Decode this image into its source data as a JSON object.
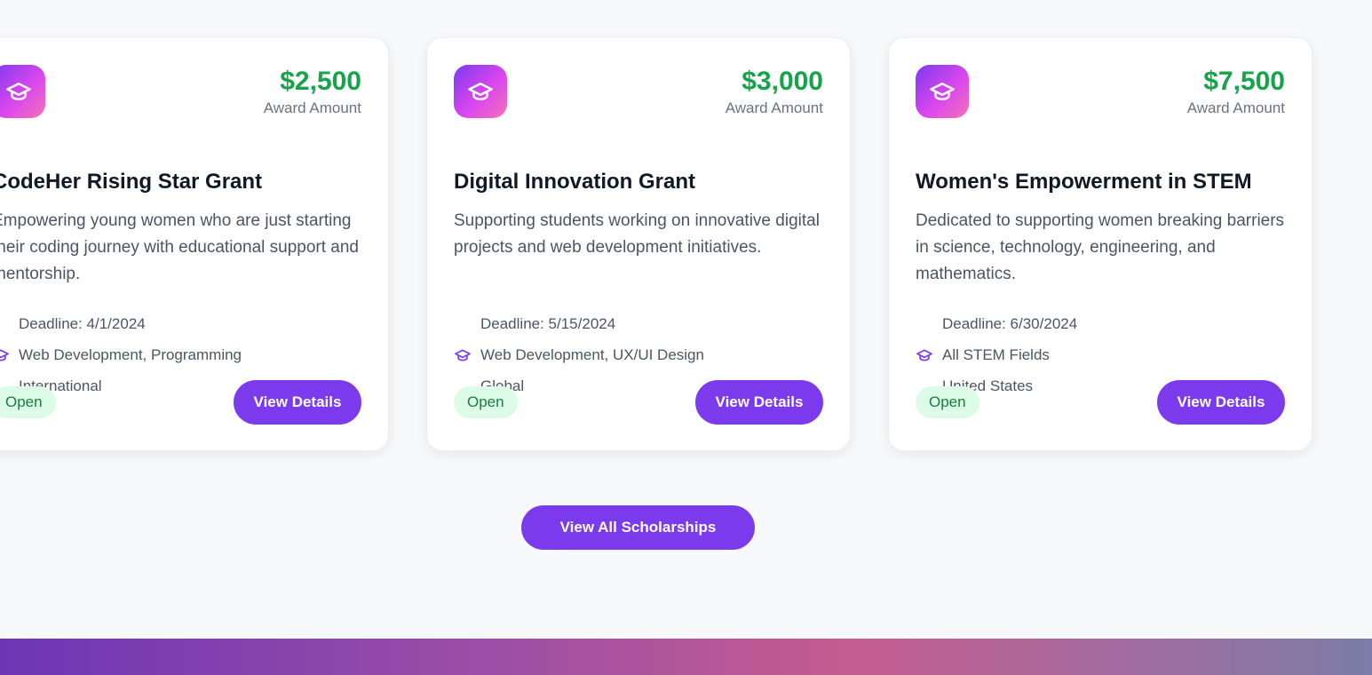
{
  "colors": {
    "accent": "#7c3aed",
    "amount": "#16a34a",
    "status_bg": "#dcfce7",
    "status_text": "#15803d"
  },
  "cards": [
    {
      "amount": "$2,500",
      "amount_label": "Award Amount",
      "title": "CodeHer Rising Star Grant",
      "description": "Empowering young women who are just starting their coding journey with educational support and mentorship.",
      "deadline": "Deadline: 4/1/2024",
      "fields": "Web Development, Programming",
      "region": "International",
      "status": "Open",
      "button": "View Details",
      "icon": "graduation-cap-icon"
    },
    {
      "amount": "$3,000",
      "amount_label": "Award Amount",
      "title": "Digital Innovation Grant",
      "description": "Supporting students working on innovative digital projects and web development initiatives.",
      "deadline": "Deadline: 5/15/2024",
      "fields": "Web Development, UX/UI Design",
      "region": "Global",
      "status": "Open",
      "button": "View Details",
      "icon": "graduation-cap-icon"
    },
    {
      "amount": "$7,500",
      "amount_label": "Award Amount",
      "title": "Women's Empowerment in STEM",
      "description": "Dedicated to supporting women breaking barriers in science, technology, engineering, and mathematics.",
      "deadline": "Deadline: 6/30/2024",
      "fields": "All STEM Fields",
      "region": "United States",
      "status": "Open",
      "button": "View Details",
      "icon": "graduation-cap-icon"
    }
  ],
  "view_all_label": "View All Scholarships"
}
